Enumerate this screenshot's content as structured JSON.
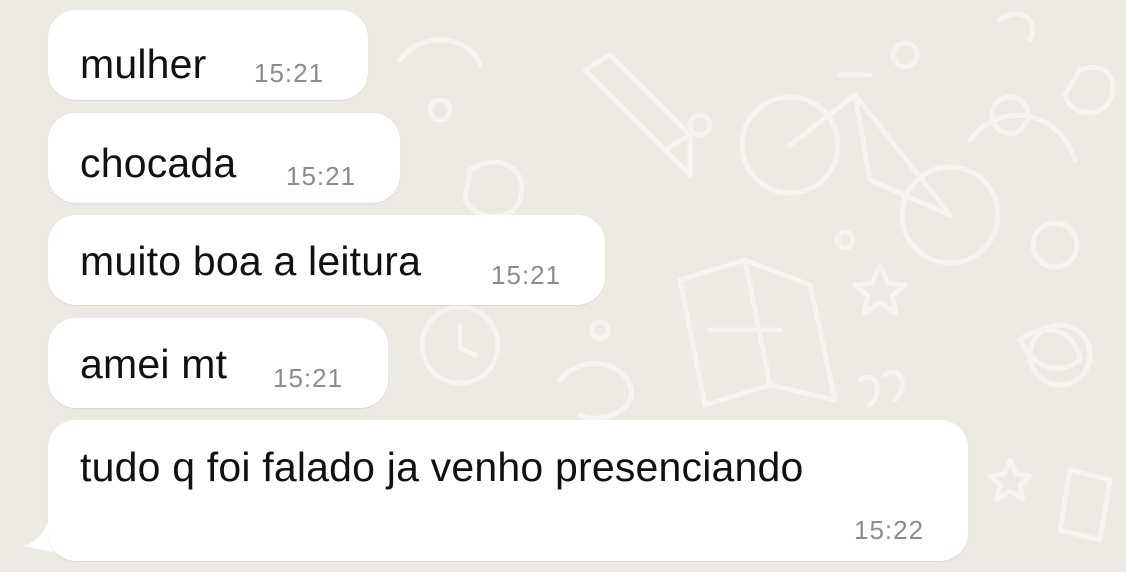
{
  "chat": {
    "background_color": "#ece8e2",
    "bubble_color": "#ffffff",
    "messages": [
      {
        "text": "mulher",
        "time": "15:21"
      },
      {
        "text": "chocada",
        "time": "15:21"
      },
      {
        "text": "muito boa a leitura",
        "time": "15:21"
      },
      {
        "text": "amei mt",
        "time": "15:21"
      },
      {
        "text": "tudo q foi falado ja venho presenciando",
        "time": "15:22"
      }
    ]
  }
}
